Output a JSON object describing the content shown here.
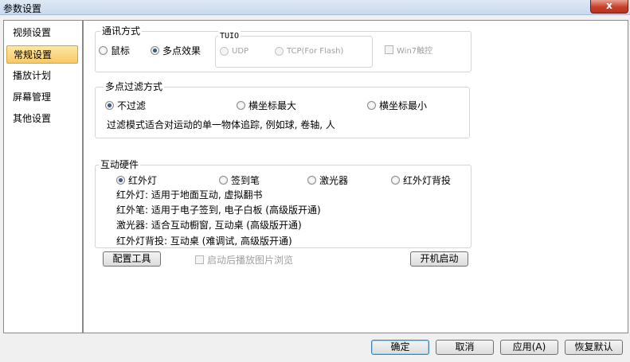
{
  "window": {
    "title": "参数设置",
    "close_glyph": "x"
  },
  "sidebar": {
    "items": [
      {
        "label": "视频设置"
      },
      {
        "label": "常规设置",
        "active": true
      },
      {
        "label": "播放计划"
      },
      {
        "label": "屏幕管理"
      },
      {
        "label": "其他设置"
      }
    ]
  },
  "communication": {
    "legend": "通讯方式",
    "mouse_label": "鼠标",
    "multipoint_label": "多点效果",
    "selected": "多点效果",
    "tuio": {
      "legend": "TUIO",
      "udp_label": "UDP",
      "tcp_label": "TCP(For Flash)"
    },
    "win7_label": "Win7触控"
  },
  "filter": {
    "legend": "多点过滤方式",
    "options": [
      "不过滤",
      "横坐标最大",
      "横坐标最小"
    ],
    "selected": "不过滤",
    "description": "过滤模式适合对运动的单一物体追踪, 例如球, 卷轴, 人"
  },
  "hardware": {
    "legend": "互动硬件",
    "options": [
      "红外灯",
      "签到笔",
      "激光器",
      "红外灯背投"
    ],
    "selected": "红外灯",
    "descriptions": [
      "红外灯: 适用于地面互动, 虚拟翻书",
      "红外笔: 适用于电子签到, 电子白板 (高级版开通)",
      "激光器: 适合互动橱窗, 互动桌 (高级版开通)",
      "红外灯背投: 互动桌 (难调试, 高级版开通)"
    ]
  },
  "actions": {
    "config_tool": "配置工具",
    "autoplay_label": "启动后播放图片浏览",
    "startup": "开机启动"
  },
  "footer": {
    "ok": "确定",
    "cancel": "取消",
    "apply": "应用(A)",
    "restore": "恢复默认"
  }
}
